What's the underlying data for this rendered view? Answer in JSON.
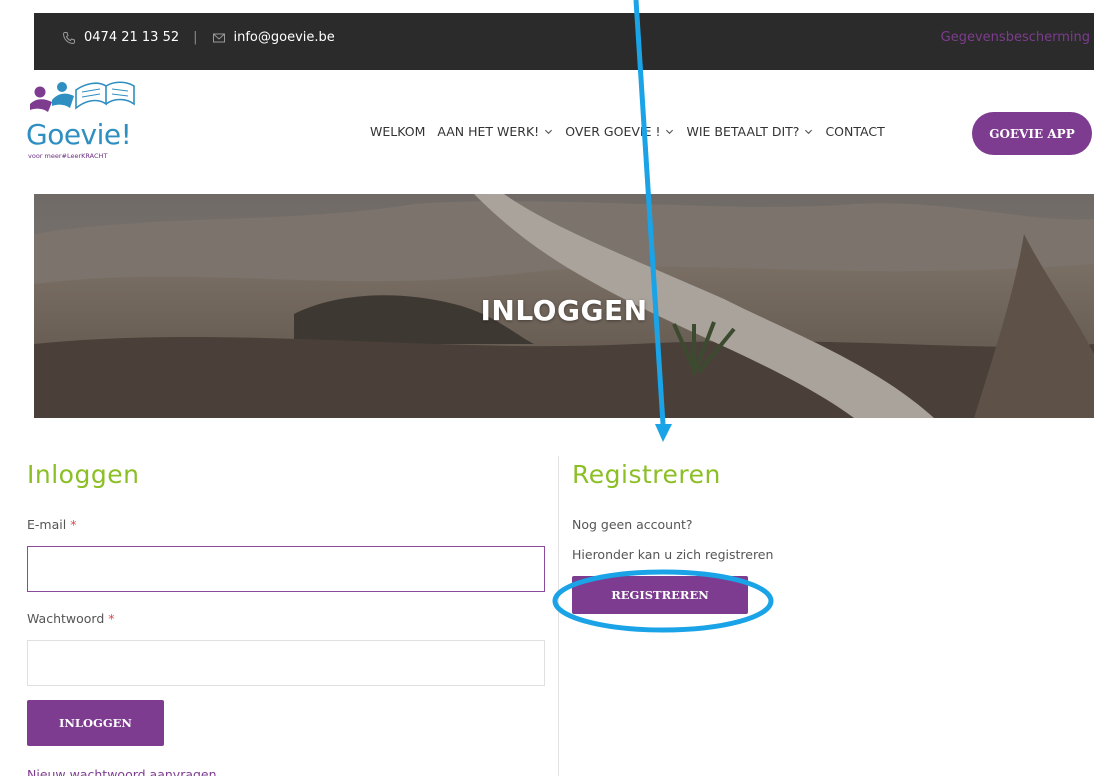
{
  "topbar": {
    "phone": "0474 21 13 52",
    "email": "info@goevie.be",
    "privacy": "Gegevensbescherming"
  },
  "logo": {
    "word": "Goevie!",
    "tagline": "voor meer#LeerKRACHT"
  },
  "nav": {
    "items": [
      {
        "label": "WELKOM",
        "dropdown": false
      },
      {
        "label": "AAN HET WERK!",
        "dropdown": true
      },
      {
        "label": "OVER GOEVIE !",
        "dropdown": true
      },
      {
        "label": "WIE BETAALT DIT?",
        "dropdown": true
      },
      {
        "label": "CONTACT",
        "dropdown": false
      }
    ],
    "app_button": "GOEVIE APP"
  },
  "hero": {
    "title": "INLOGGEN"
  },
  "login": {
    "heading": "Inloggen",
    "email_label": "E-mail",
    "password_label": "Wachtwoord",
    "required_mark": "*",
    "email_value": "",
    "password_value": "",
    "submit": "INLOGGEN",
    "forgot": "Nieuw wachtwoord aanvragen"
  },
  "register": {
    "heading": "Registreren",
    "line1": "Nog geen account?",
    "line2": "Hieronder kan u zich registreren",
    "button": "REGISTREREN"
  },
  "colors": {
    "purple": "#7d3c8f",
    "green": "#8cbf26",
    "annotation_blue": "#1aa3e6",
    "topbar": "#2b2b2b"
  }
}
